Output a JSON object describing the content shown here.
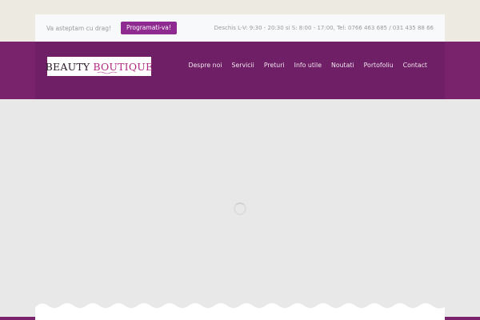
{
  "topbar": {
    "welcome": "Va asteptam cu drag!",
    "cta_label": "Programati-va!",
    "hours": "Deschis L-V: 9:30 - 20:30 si S: 8:00 - 17:00, Tel: 0766 463 685 / 031 435 88 66"
  },
  "logo": {
    "word1": "BEAUTY",
    "word2": "BOUTIQUE"
  },
  "nav": {
    "items": [
      "Despre noi",
      "Servicii",
      "Preturi",
      "Info utile",
      "Noutati",
      "Portofoliu",
      "Contact"
    ]
  },
  "colors": {
    "brand_purple": "#7a236d",
    "cta_purple": "#8e2a90",
    "logo_pink": "#b0287f"
  }
}
